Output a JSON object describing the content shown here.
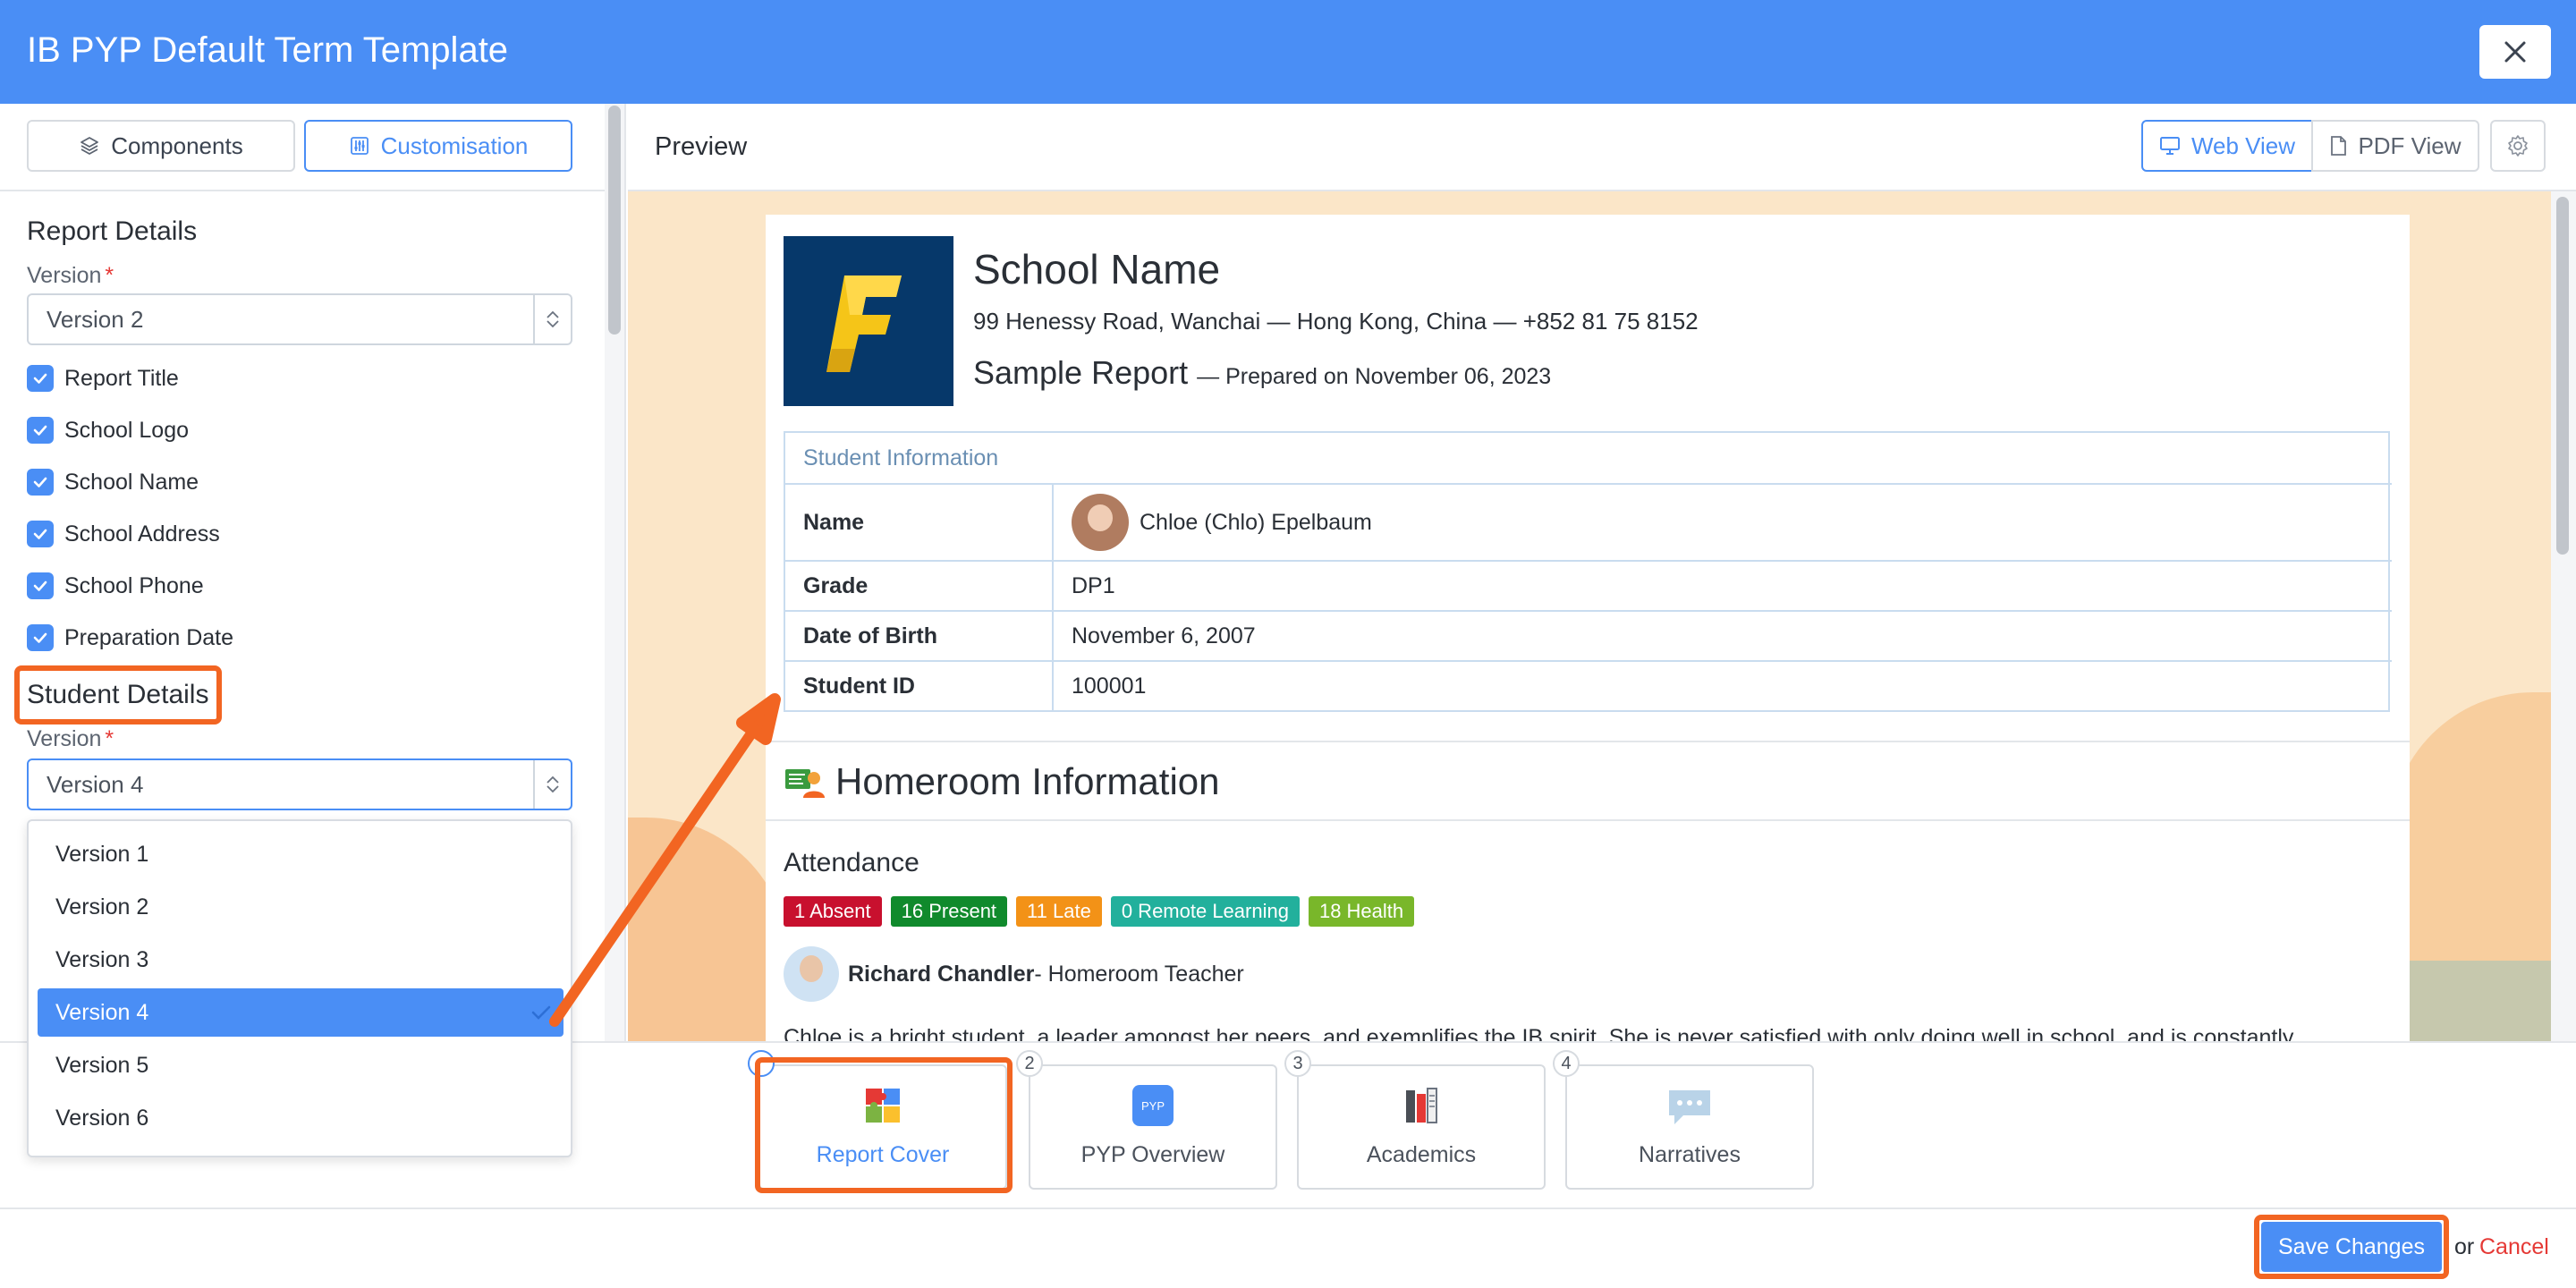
{
  "window": {
    "title": "IB PYP Default Term Template"
  },
  "left_tabs": [
    {
      "label": "Components",
      "icon": "layers-icon"
    },
    {
      "label": "Customisation",
      "icon": "sliders-icon"
    }
  ],
  "report_details": {
    "heading": "Report Details",
    "version_label": "Version",
    "required_mark": "*",
    "version_value": "Version 2",
    "checkboxes": [
      {
        "label": "Report Title",
        "checked": true
      },
      {
        "label": "School Logo",
        "checked": true
      },
      {
        "label": "School Name",
        "checked": true
      },
      {
        "label": "School Address",
        "checked": true
      },
      {
        "label": "School Phone",
        "checked": true
      },
      {
        "label": "Preparation Date",
        "checked": true
      }
    ]
  },
  "student_details": {
    "heading": "Student Details",
    "version_label": "Version",
    "required_mark": "*",
    "version_value": "Version 4",
    "options": [
      "Version 1",
      "Version 2",
      "Version 3",
      "Version 4",
      "Version 5",
      "Version 6"
    ],
    "selected": "Version 4"
  },
  "preview": {
    "title": "Preview",
    "web_view": "Web View",
    "pdf_view": "PDF View",
    "active_view": "Web View"
  },
  "report": {
    "school_name": "School Name",
    "address_line": "99 Henessy Road, Wanchai — Hong Kong, China — +852 81 75 8152",
    "sample_title": "Sample Report",
    "prepared": "— Prepared on November 06, 2023",
    "student_info": {
      "heading": "Student Information",
      "rows": [
        {
          "key": "Name",
          "value": "Chloe (Chlo) Epelbaum"
        },
        {
          "key": "Grade",
          "value": "DP1"
        },
        {
          "key": "Date of Birth",
          "value": "November 6, 2007"
        },
        {
          "key": "Student ID",
          "value": "100001"
        }
      ]
    },
    "homeroom_heading": "Homeroom Information",
    "attendance_heading": "Attendance",
    "badges": [
      {
        "label": "1 Absent",
        "color": "#c8102e"
      },
      {
        "label": "16 Present",
        "color": "#108a2c"
      },
      {
        "label": "11 Late",
        "color": "#f39217"
      },
      {
        "label": "0 Remote Learning",
        "color": "#22b09c"
      },
      {
        "label": "18 Health",
        "color": "#79b72a"
      }
    ],
    "teacher_name": "Richard Chandler",
    "teacher_role": "- Homeroom Teacher",
    "narrative": "Chloe is a bright student, a leader amongst her peers, and exemplifies the IB spirit. She is never satisfied with only doing well in school, and is constantly"
  },
  "steps": [
    {
      "num": "1",
      "label": "Report Cover",
      "icon": "puzzle-icon"
    },
    {
      "num": "2",
      "label": "PYP Overview",
      "icon": "pyp-icon",
      "icon_text": "PYP"
    },
    {
      "num": "3",
      "label": "Academics",
      "icon": "books-icon"
    },
    {
      "num": "4",
      "label": "Narratives",
      "icon": "speech-bubble-icon"
    }
  ],
  "footer": {
    "save_label": "Save Changes",
    "or_text": "or",
    "cancel_label": "Cancel"
  },
  "colors": {
    "accent": "#4a8ef5",
    "highlight": "#f26522",
    "cancel": "#e53935"
  }
}
